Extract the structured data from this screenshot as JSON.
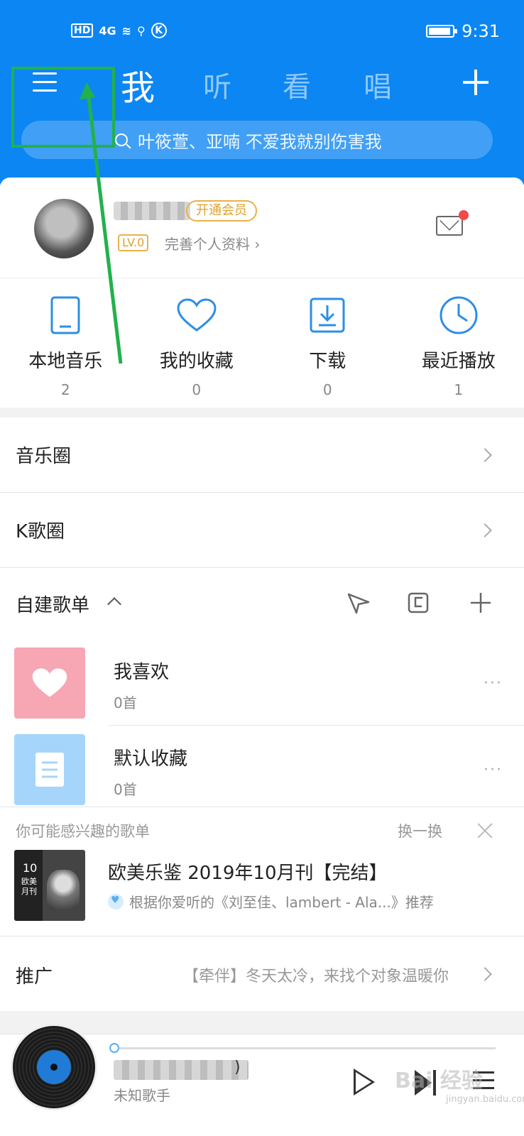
{
  "status_bar": {
    "network": "HD",
    "signal": "4G",
    "time": "9:31",
    "k_label": "K"
  },
  "header": {
    "tabs": [
      "我",
      "听",
      "看",
      "唱"
    ],
    "active_tab": "我",
    "search_placeholder": "叶筱萱、亚喃 不爱我就别伤害我"
  },
  "profile": {
    "vip_label": "开通会员",
    "level": "LV.0",
    "complete_profile": "完善个人资料 ›"
  },
  "quick_actions": [
    {
      "label": "本地音乐",
      "count": "2",
      "icon": "phone-icon"
    },
    {
      "label": "我的收藏",
      "count": "0",
      "icon": "heart-icon"
    },
    {
      "label": "下载",
      "count": "0",
      "icon": "download-icon"
    },
    {
      "label": "最近播放",
      "count": "1",
      "icon": "clock-icon"
    }
  ],
  "sections": {
    "music_circle": "音乐圈",
    "k_song_circle": "K歌圈"
  },
  "playlists": {
    "header": "自建歌单",
    "items": [
      {
        "name": "我喜欢",
        "count": "0首",
        "cover_color": "#f7a6b4"
      },
      {
        "name": "默认收藏",
        "count": "0首",
        "cover_color": "#a6d5fb"
      }
    ]
  },
  "recommend": {
    "header": "你可能感兴趣的歌单",
    "refresh": "换一换",
    "title": "欧美乐鉴 2019年10月刊【完结】",
    "reason": "根据你爱听的《刘至佳、lambert - Ala...》推荐",
    "cover_number": "10",
    "cover_text": "欧美\n月刊"
  },
  "promo": {
    "label": "推广",
    "text": "【牵伴】冬天太冷，来找个对象温暖你"
  },
  "player": {
    "paren": ")",
    "artist": "未知歌手",
    "progress": 0.0
  },
  "watermark": {
    "main": "Bai 经验",
    "sub": "jingyan.baidu.com"
  },
  "colors": {
    "header_blue": "#0c86f3",
    "accent_blue": "#2d8ee6",
    "vip_gold": "#e0a12a",
    "annotation_green": "#22b14c"
  }
}
